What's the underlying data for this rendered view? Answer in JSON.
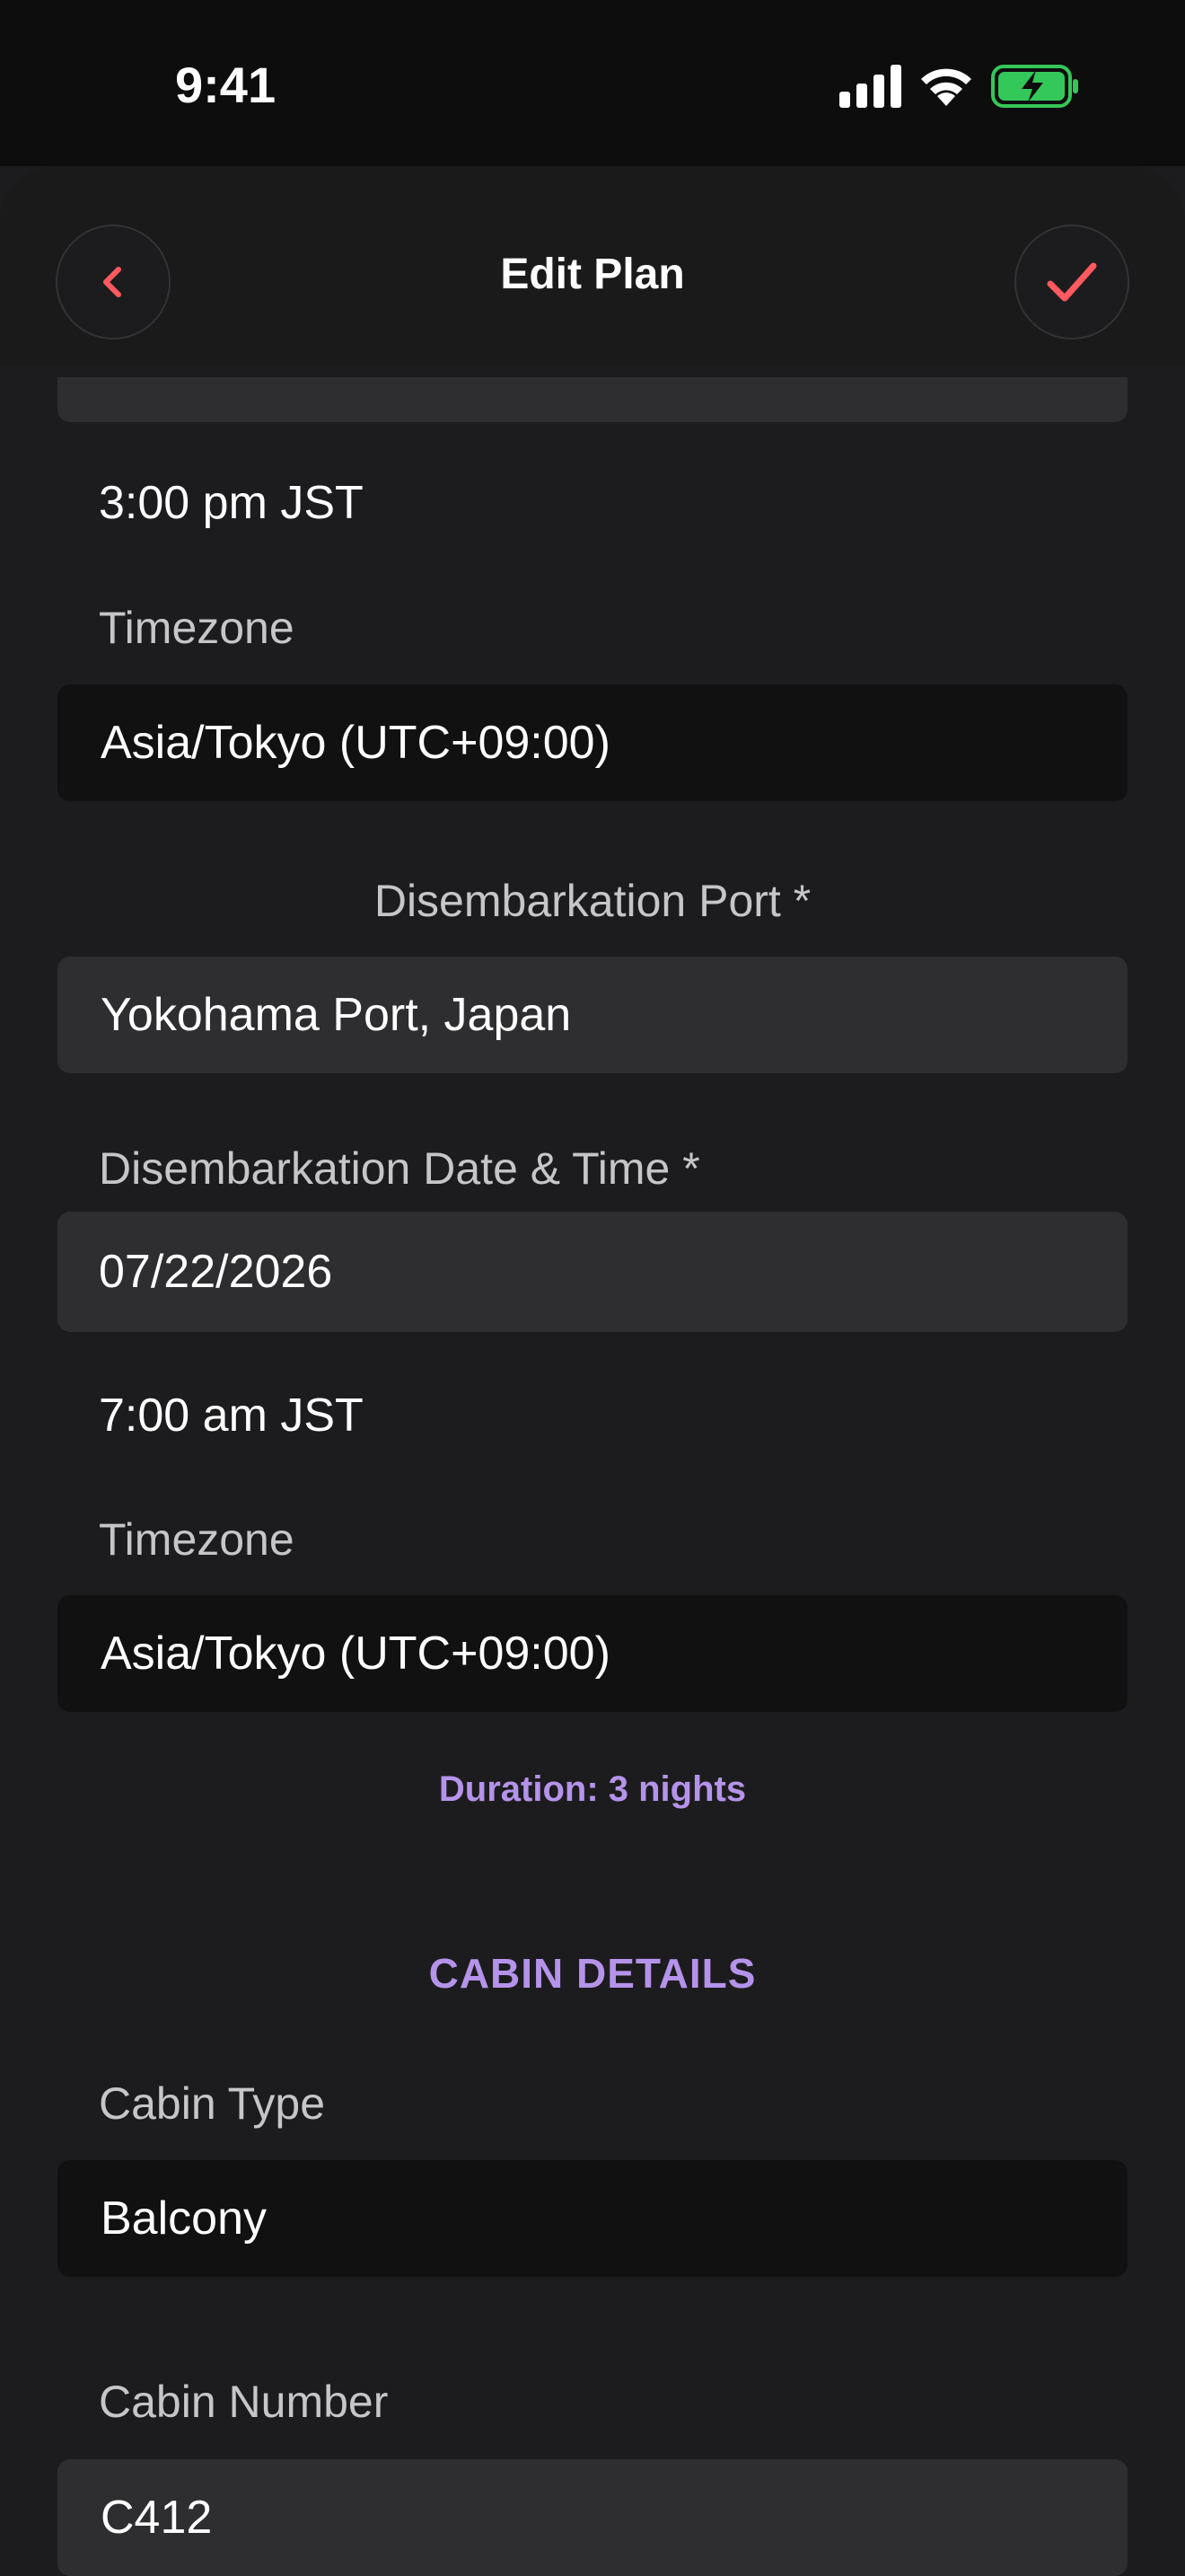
{
  "status_bar": {
    "time": "9:41",
    "icons": [
      "signal-icon",
      "wifi-icon",
      "battery-charging-icon"
    ],
    "battery_color": "#34c759"
  },
  "header": {
    "title": "Edit Plan",
    "back_icon": "chevron-left-icon",
    "confirm_icon": "checkmark-icon",
    "accent_color": "#ff5a5f"
  },
  "embarkation": {
    "time_value": "3:00 pm JST",
    "timezone_label": "Timezone",
    "timezone_value": "Asia/Tokyo (UTC+09:00)"
  },
  "disembarkation": {
    "port_label": "Disembarkation Port *",
    "port_value": "Yokohama Port, Japan",
    "datetime_label": "Disembarkation Date & Time *",
    "date_value": "07/22/2026",
    "time_value": "7:00 am JST",
    "timezone_label": "Timezone",
    "timezone_value": "Asia/Tokyo (UTC+09:00)"
  },
  "duration_text": "Duration: 3 nights",
  "cabin": {
    "heading": "CABIN DETAILS",
    "type_label": "Cabin Type",
    "type_value": "Balcony",
    "number_label": "Cabin Number",
    "number_value": "C412"
  },
  "colors": {
    "background": "#1c1c1e",
    "accent_purple": "#b593ea",
    "field_dark": "#111111",
    "field_grey": "#2e2e30"
  }
}
